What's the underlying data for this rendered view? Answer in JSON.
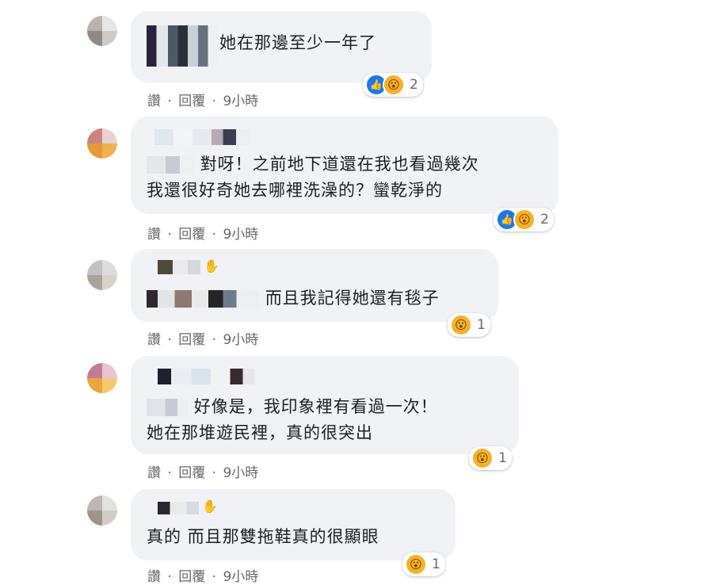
{
  "reaction_colors": {
    "like": "#1877f2",
    "wow": "#f7b125"
  },
  "icons": {
    "like": "thumbs-up-icon",
    "wow": "wow-face-icon",
    "wave": "wave-hand-icon"
  },
  "comments": [
    {
      "text_lines": [
        "她在那邊至少一年了"
      ],
      "reaction_count": "2",
      "actions": {
        "like": "讚",
        "reply": "回覆",
        "separator": "·",
        "time": "9小時"
      }
    },
    {
      "text_lines": [
        "對呀！之前地下道還在我也看過幾次",
        "我還很好奇她去哪裡洗澡的？蠻乾淨的"
      ],
      "reaction_count": "2",
      "actions": {
        "like": "讚",
        "reply": "回覆",
        "separator": "·",
        "time": "9小時"
      }
    },
    {
      "text_lines": [
        "而且我記得她還有毯子"
      ],
      "reaction_count": "1",
      "actions": {
        "like": "讚",
        "reply": "回覆",
        "separator": "·",
        "time": "9小時"
      }
    },
    {
      "text_lines": [
        "好像是，我印象裡有看過一次！",
        "她在那堆遊民裡，真的很突出"
      ],
      "reaction_count": "1",
      "actions": {
        "like": "讚",
        "reply": "回覆",
        "separator": "·",
        "time": "9小時"
      }
    },
    {
      "text_lines": [
        "真的 而且那雙拖鞋真的很顯眼"
      ],
      "reaction_count": "1",
      "actions": {
        "like": "讚",
        "reply": "回覆",
        "separator": "·",
        "time": "9小時"
      }
    }
  ]
}
